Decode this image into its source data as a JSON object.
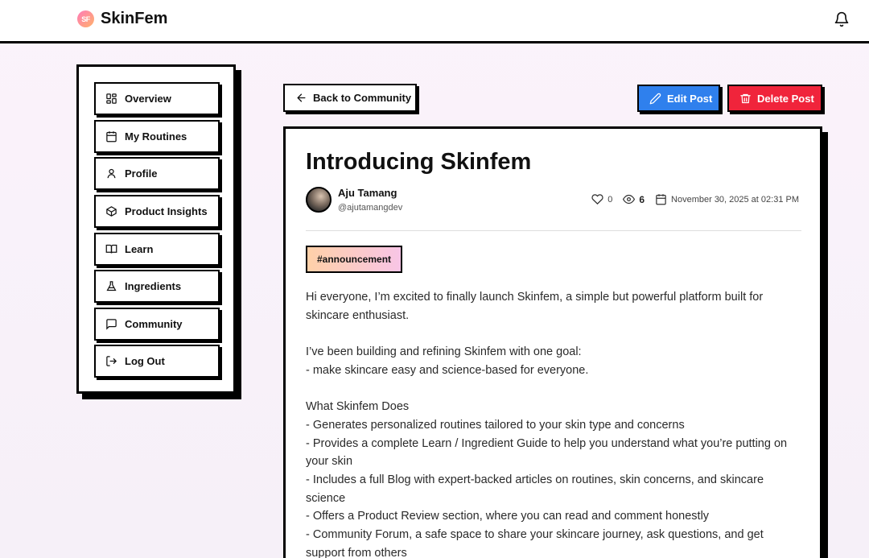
{
  "header": {
    "logo_text": "SF",
    "brand": "SkinFem",
    "bell_icon": "bell-icon"
  },
  "sidebar": {
    "items": [
      {
        "label": "Overview",
        "icon": "grid-icon"
      },
      {
        "label": "My Routines",
        "icon": "calendar-icon"
      },
      {
        "label": "Profile",
        "icon": "user-icon"
      },
      {
        "label": "Product Insights",
        "icon": "box-icon"
      },
      {
        "label": "Learn",
        "icon": "book-icon"
      },
      {
        "label": "Ingredients",
        "icon": "flask-icon"
      },
      {
        "label": "Community",
        "icon": "message-icon"
      },
      {
        "label": "Log Out",
        "icon": "logout-icon"
      }
    ]
  },
  "actions": {
    "back_label": "Back to Community",
    "edit_label": "Edit Post",
    "delete_label": "Delete Post",
    "edit_color": "#2f80ed",
    "delete_color": "#f0243b"
  },
  "post": {
    "title": "Introducing Skinfem",
    "author_name": "Aju Tamang",
    "author_handle": "@ajutamangdev",
    "likes": "0",
    "views": "6",
    "date": "November 30, 2025 at 02:31 PM",
    "tag": "#announcement",
    "body": [
      "Hi everyone, I’m excited to finally launch Skinfem, a simple but powerful platform built for skincare enthusiast.",
      "",
      "I’ve been building and refining Skinfem with one goal:",
      "- make skincare easy and science-based for everyone.",
      "",
      "What Skinfem Does",
      "- Generates personalized routines tailored to your skin type and concerns",
      "- Provides a complete Learn / Ingredient Guide to help you understand what you’re putting on your skin",
      "- Includes a full Blog with expert-backed articles on routines, skin concerns, and skincare science",
      "- Offers a Product Review section, where you can read and comment honestly",
      "- Community Forum, a safe space to share your skincare journey, ask questions, and get support from others"
    ]
  }
}
